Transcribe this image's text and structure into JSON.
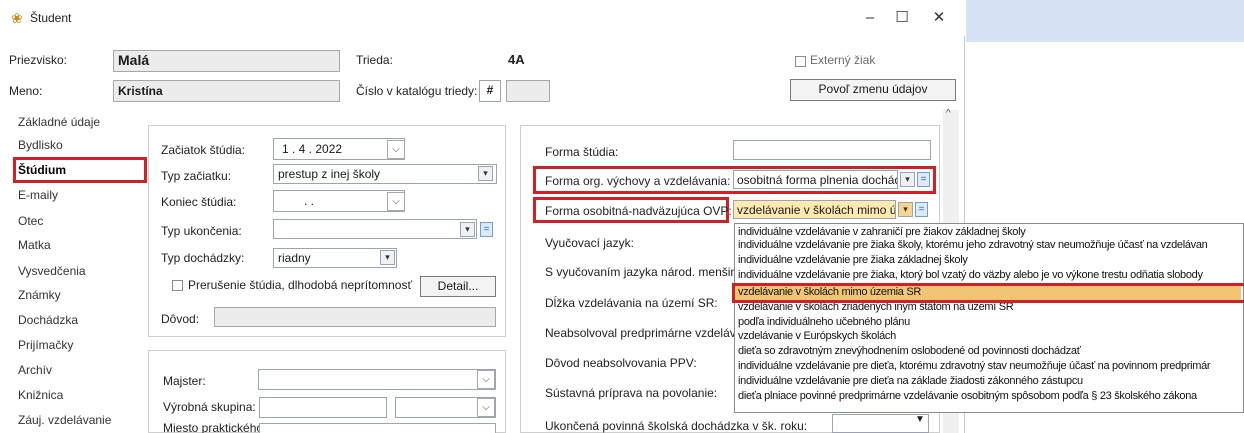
{
  "window": {
    "title": "Študent",
    "minimize": "–",
    "maximize": "☐",
    "close": "✕"
  },
  "header": {
    "surname_label": "Priezvisko:",
    "surname_value": "Malá",
    "name_label": "Meno:",
    "name_value": "Kristína",
    "class_label": "Trieda:",
    "class_value": "4A",
    "catalog_label": "Číslo v katalógu triedy:",
    "catalog_hash": "#",
    "catalog_value": "",
    "external_label": "Externý žiak",
    "edit_button": "Povoľ zmenu údajov"
  },
  "sidebar": {
    "items": [
      "Základné údaje",
      "Bydlisko",
      "Štúdium",
      "E-maily",
      "Otec",
      "Matka",
      "Vysvedčenia",
      "Známky",
      "Dochádzka",
      "Prijímačky",
      "Archív",
      "Knižnica",
      "Záuj. vzdelávanie"
    ],
    "active": "Štúdium"
  },
  "study": {
    "start_label": "Začiatok štúdia:",
    "start_value": "1 .  4 . 2022",
    "start_type_label": "Typ začiatku:",
    "start_type_value": "prestup z inej školy",
    "end_label": "Koniec štúdia:",
    "end_value": ".      .",
    "end_type_label": "Typ ukončenia:",
    "end_type_value": "",
    "attendance_label": "Typ dochádzky:",
    "attendance_value": "riadny",
    "interruption_label": "Prerušenie štúdia, dlhodobá neprítomnosť",
    "detail_button": "Detail...",
    "reason_label": "Dôvod:",
    "reason_value": ""
  },
  "training": {
    "master_label": "Majster:",
    "group_label": "Výrobná skupina:",
    "place_label": "Miesto praktického"
  },
  "right": {
    "form_label": "Forma štúdia:",
    "form_value": "",
    "org_label": "Forma org. výchovy a vzdelávania:",
    "org_value": "osobitná forma plnenia dochád",
    "ovp_label": "Forma osobitná-nadväzujúca OVP:",
    "ovp_value": "vzdelávanie v školách mimo úz",
    "language_label": "Vyučovací jazyk:",
    "minority_label": "S vyučovaním jazyka národ. menšiny:",
    "length_label": "Dĺžka vzdelávania na území SR:",
    "preprimary_label": "Neabsolvoval predprimárne vzdelávan",
    "ppv_reason_label": "Dôvod neabsolvovania PPV:",
    "system_label": "Sústavná príprava na povolanie:",
    "compulsory_label": "Ukončená povinná školská dochádzka v šk. roku:"
  },
  "dropdown_list": {
    "items": [
      "individuálne vzdelávanie v zahraničí pre žiakov základnej školy",
      "individuálne vzdelávanie pre žiaka školy, ktorému jeho zdravotný stav neumožňuje účasť na vzdelávan",
      "individuálne vzdelávanie pre žiaka základnej školy",
      "individuálne vzdelávanie pre žiaka, ktorý bol vzatý do väzby alebo je vo výkone trestu odňatia slobody",
      "vzdelávanie v školách mimo územia SR",
      "vzdelávanie v školách zriadených iným štátom na území SR",
      "podľa individuálneho učebného plánu",
      "vzdelávanie v Európskych školách",
      "dieťa so zdravotným znevýhodnením oslobodené od povinnosti dochádzať",
      "individuálne vzdelávanie pre dieťa, ktorému zdravotný stav neumožňuje účasť na povinnom predprimár",
      "individuálne vzdelávanie pre dieťa na základe žiadosti zákonného zástupcu",
      "dieťa plniace povinné predprimárne vzdelávanie osobitným spôsobom podľa § 23 školského zákona"
    ],
    "selected": "vzdelávanie v školách mimo územia SR"
  },
  "colors": {
    "highlight": "#d32027",
    "selection": "#f0c674",
    "accent": "#2b6bc5"
  }
}
